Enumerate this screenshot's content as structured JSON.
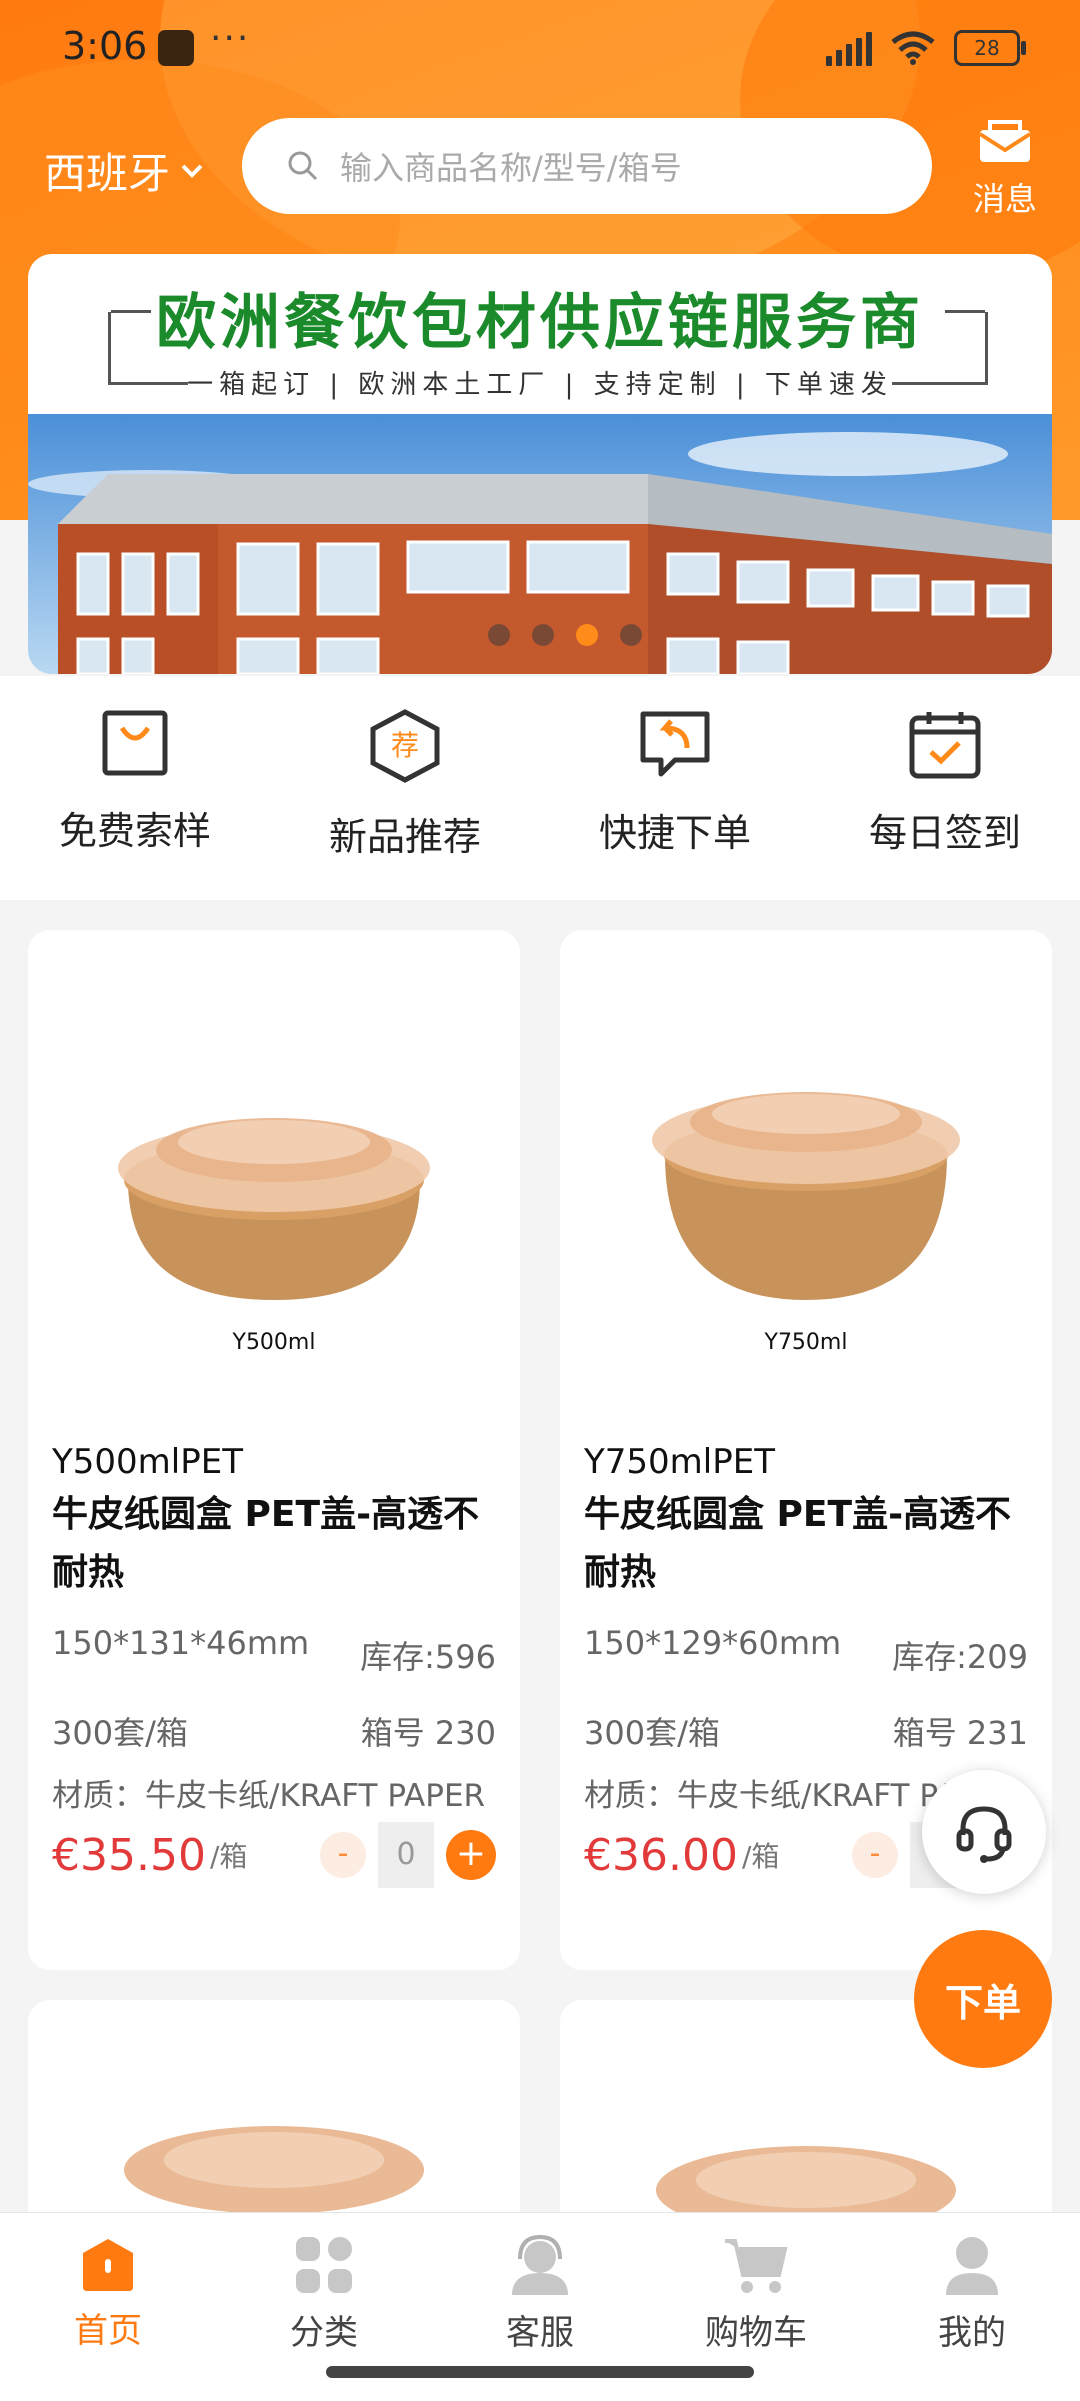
{
  "status_bar": {
    "time": "3:06",
    "battery": "28"
  },
  "header": {
    "region": "西班牙",
    "search_placeholder": "输入商品名称/型号/箱号",
    "message_label": "消息"
  },
  "banner": {
    "title": "欧洲餐饮包材供应链服务商",
    "subtitle": "一箱起订 | 欧洲本土工厂 | 支持定制 | 下单速发",
    "dots_count": 4,
    "active_dot": 2
  },
  "quick_menu": [
    {
      "label": "免费索样",
      "icon": "bag-icon"
    },
    {
      "label": "新品推荐",
      "icon": "recommend-hexagon-icon",
      "badge": "荐"
    },
    {
      "label": "快捷下单",
      "icon": "quick-order-icon"
    },
    {
      "label": "每日签到",
      "icon": "calendar-check-icon"
    }
  ],
  "products": [
    {
      "image_label": "Y500ml",
      "code": "Y500mlPET",
      "name": "牛皮纸圆盒 PET盖-高透不耐热",
      "size": "150*131*46mm",
      "stock": "库存:596",
      "pack": "300套/箱",
      "box_no": "箱号 230",
      "material": "材质：牛皮卡纸/KRAFT PAPER",
      "price": "€35.50",
      "unit": "/箱",
      "qty": "0"
    },
    {
      "image_label": "Y750ml",
      "code": "Y750mlPET",
      "name": "牛皮纸圆盒 PET盖-高透不耐热",
      "size": "150*129*60mm",
      "stock": "库存:209",
      "pack": "300套/箱",
      "box_no": "箱号 231",
      "material": "材质：牛皮卡纸/KRAFT PAPER",
      "price": "€36.00",
      "unit": "/箱",
      "qty": "0"
    }
  ],
  "floating": {
    "order_label": "下单",
    "cs_icon": "headset-icon"
  },
  "bottom_nav": [
    {
      "label": "首页",
      "icon": "home-icon",
      "active": true
    },
    {
      "label": "分类",
      "icon": "category-icon",
      "active": false
    },
    {
      "label": "客服",
      "icon": "customer-service-icon",
      "active": false
    },
    {
      "label": "购物车",
      "icon": "cart-icon",
      "active": false
    },
    {
      "label": "我的",
      "icon": "profile-icon",
      "active": false
    }
  ],
  "colors": {
    "accent": "#ff7a10",
    "price": "#e23a3a",
    "banner_title": "#1a8a2a"
  }
}
